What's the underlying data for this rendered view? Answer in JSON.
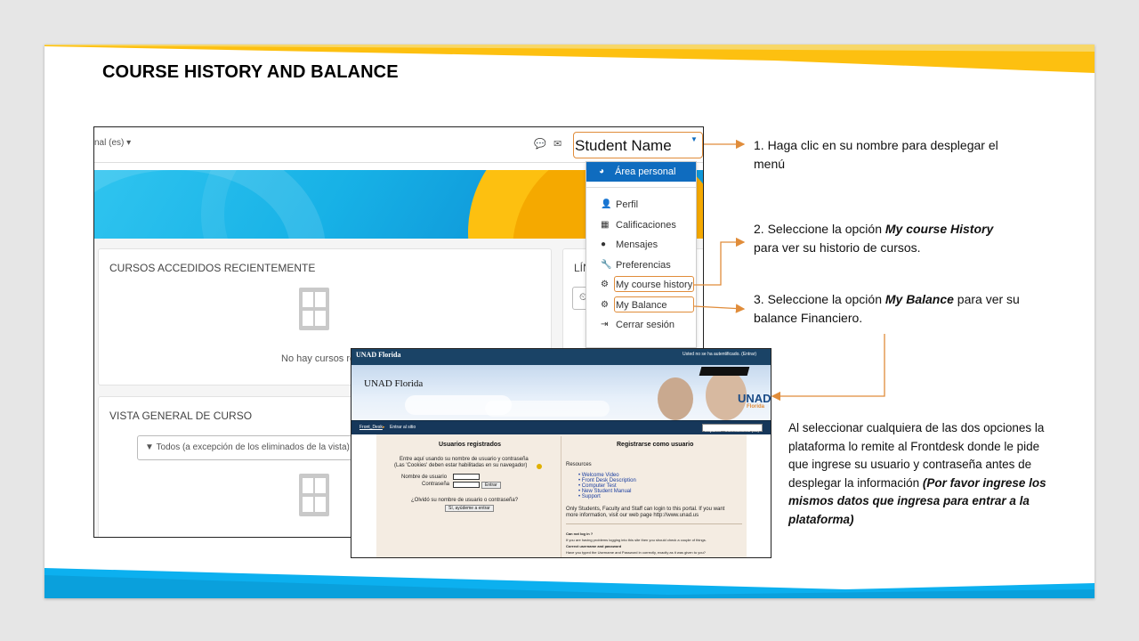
{
  "slide": {
    "title": "COURSE HISTORY AND BALANCE"
  },
  "moodle": {
    "language_selector": "nal (es)",
    "student_name": "Student Name",
    "dropdown_items": [
      {
        "icon": "dashboard-icon",
        "label": "Área personal"
      },
      {
        "icon": "user-icon",
        "label": "Perfil"
      },
      {
        "icon": "table-icon",
        "label": "Calificaciones"
      },
      {
        "icon": "chat-bubble-icon",
        "label": "Mensajes"
      },
      {
        "icon": "wrench-icon",
        "label": "Preferencias"
      },
      {
        "icon": "gear-icon",
        "label": "My course history"
      },
      {
        "icon": "gear-icon",
        "label": "My Balance"
      },
      {
        "icon": "logout-icon",
        "label": "Cerrar sesión"
      }
    ],
    "recent_courses_title": "CURSOS ACCEDIDOS RECIENTEMENTE",
    "recent_courses_empty": "No hay cursos reci",
    "timeline_title": "LÍN",
    "overview_title": "VISTA GENERAL DE CURSO",
    "filter_label": "Todos (a excepción de los eliminados de la vista)"
  },
  "annotations": {
    "step1": "1. Haga clic en su nombre para desplegar el menú",
    "step2_prefix": "2. Seleccione  la opción ",
    "step2_bold": "My course History",
    "step2_suffix": " para ver su historio de cursos.",
    "step3_prefix": "3. Seleccione  la opción ",
    "step3_bold": "My Balance",
    "step3_suffix": " para ver su balance  Financiero.",
    "note_text": "Al seleccionar cualquiera de las dos opciones la plataforma lo remite al Frontdesk donde  le pide que ingrese su usuario y contraseña antes de desplegar la información ",
    "note_bold": "(Por favor ingrese los mismos datos que ingresa para entrar a la plataforma)"
  },
  "frontdesk": {
    "brand": "UNAD Florida",
    "auth_status": "Usted no se ha autentificado. (Entrar)",
    "banner_title": "UNAD Florida",
    "logo_main": "UNAD",
    "logo_sub": "Florida",
    "breadcrumb_home": "Front_Desk",
    "breadcrumb_current": "Entrar al sitio",
    "language_select": "Español - Internacional (es)",
    "registered_heading": "Usuarios registrados",
    "registered_line1": "Entre aquí usando su nombre de usuario y contraseña",
    "registered_line2": "(Las 'Cookies' deben estar habilitadas en su navegador)",
    "username_label": "Nombre de usuario",
    "password_label": "Contraseña",
    "login_button": "Entrar",
    "forgot_text": "¿Olvidó su nombre de usuario o contraseña?",
    "help_button": "Sí, ayúdeme a entrar",
    "register_heading": "Registrarse como usuario",
    "resources_label": "Resources",
    "resource_links": [
      "Welcome Video",
      "Front Desk Description",
      "Computer Test",
      "New Student Manual",
      "Support"
    ],
    "info_line1": "Only Students, Faculty and Staff can login to this portal. If you want",
    "info_line2": "more information, visit our web page http://www.unad.us",
    "cant_login": "Can not log in ?",
    "cant_login_detail": "If you are having problems logging into this site then you should check a couple of things.",
    "correct_credentials": "Correct username and password",
    "correct_detail": "Have you typed the Username and Password in correctly, exactly as it was given to you?"
  },
  "colors": {
    "accent_orange": "#e08c3a",
    "moodle_blue": "#0f6cbf",
    "banner_yellow": "#fdc010",
    "banner_blue": "#0cb0ef",
    "frontdesk_navy": "#1a4366"
  }
}
